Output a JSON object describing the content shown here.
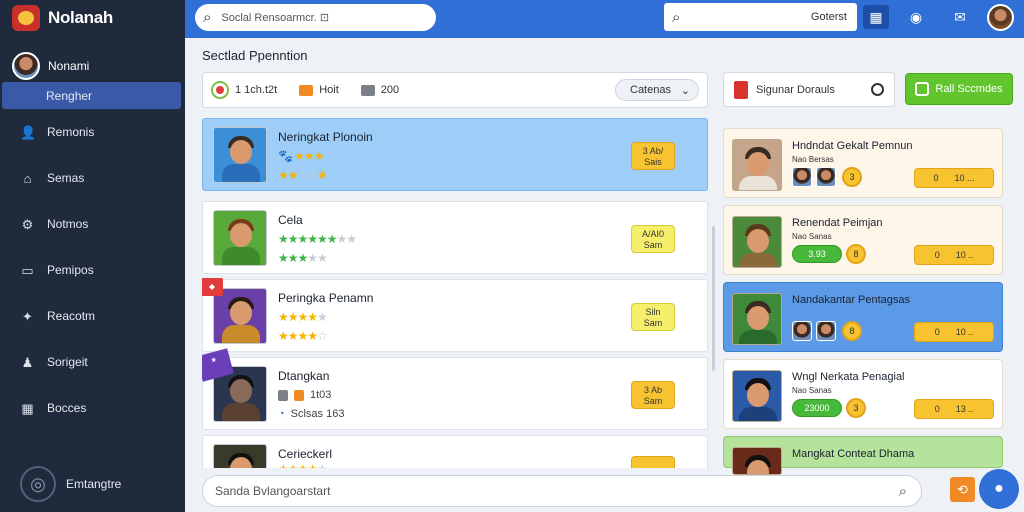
{
  "app": {
    "title": "Nolanah",
    "profile_name": "Nonami"
  },
  "sidebar": {
    "items": [
      {
        "label": "Rengher",
        "icon": "home-icon"
      },
      {
        "label": "Remonis",
        "icon": "user-icon"
      },
      {
        "label": "Semas",
        "icon": "store-icon"
      },
      {
        "label": "Notmos",
        "icon": "gear-icon"
      },
      {
        "label": "Pemipos",
        "icon": "monitor-icon"
      },
      {
        "label": "Reacotm",
        "icon": "bolt-icon"
      },
      {
        "label": "Sorigeit",
        "icon": "person-icon"
      },
      {
        "label": "Bocces",
        "icon": "grid-icon"
      }
    ],
    "settings_label": "Emtangtre"
  },
  "topbar": {
    "search_placeholder": "Soclal Rensoarmcr. ⊡",
    "field_value": "Goterst"
  },
  "main": {
    "section_title": "Sectlad Ppenntion",
    "filters": {
      "chip1": "1 1ch.t2t",
      "chip2": "Hoit",
      "chip3": "200",
      "sort_label": "Catenas"
    },
    "games": [
      {
        "title": "Neringkat Plonoin",
        "subtitle_stars": "🐾 ★★★",
        "rating": 4,
        "price_top": "3 Ab/",
        "price_bottom": "Sais"
      },
      {
        "title": "Cela",
        "rating": 3,
        "price_top": "A/AI0",
        "price_bottom": "Sam"
      },
      {
        "title": "Peringka Penamn",
        "rating": 4,
        "price_top": "Siln",
        "price_bottom": "Sam"
      },
      {
        "title": "Dtangkan",
        "sub_a": "1t03",
        "sub_b": "Sclsas 163",
        "price_top": "3 Ab",
        "price_bottom": "Sam"
      },
      {
        "title": "Cerieckerl",
        "rating": 4
      }
    ],
    "bottom_search_placeholder": "Sanda Bvlangoarstart"
  },
  "right_panel": {
    "filter_label": "Sigunar Dorauls",
    "add_button": "Rall Sccmdes",
    "cards": [
      {
        "title": "Hndndat Gekalt Pemnun",
        "subtitle": "Nao Bersas",
        "coin": "3",
        "pill_left": "0",
        "pill_right": "10 ..."
      },
      {
        "title": "Renendat Peimjan",
        "subtitle": "Nao Sanas",
        "green_pill": "3.93",
        "coin": "8",
        "pill_left": "0",
        "pill_right": "10 .."
      },
      {
        "title": "Nandakantar Pentagsas",
        "subtitle": "",
        "coin": "8",
        "pill_left": "0",
        "pill_right": "10 .."
      },
      {
        "title": "Wngl Nerkata Penagial",
        "subtitle": "Nao Sanas",
        "green_pill": "23000",
        "coin": "3",
        "pill_left": "0",
        "pill_right": "13 .."
      },
      {
        "title": "Mangkat Conteat Dhama"
      }
    ]
  },
  "colors": {
    "sidebar_bg": "#1f2a3c",
    "topbar_bg": "#2f6fd6",
    "selected_row": "#9ecdf7",
    "accent_green": "#62c52e",
    "price_yellow": "#f7c330"
  }
}
